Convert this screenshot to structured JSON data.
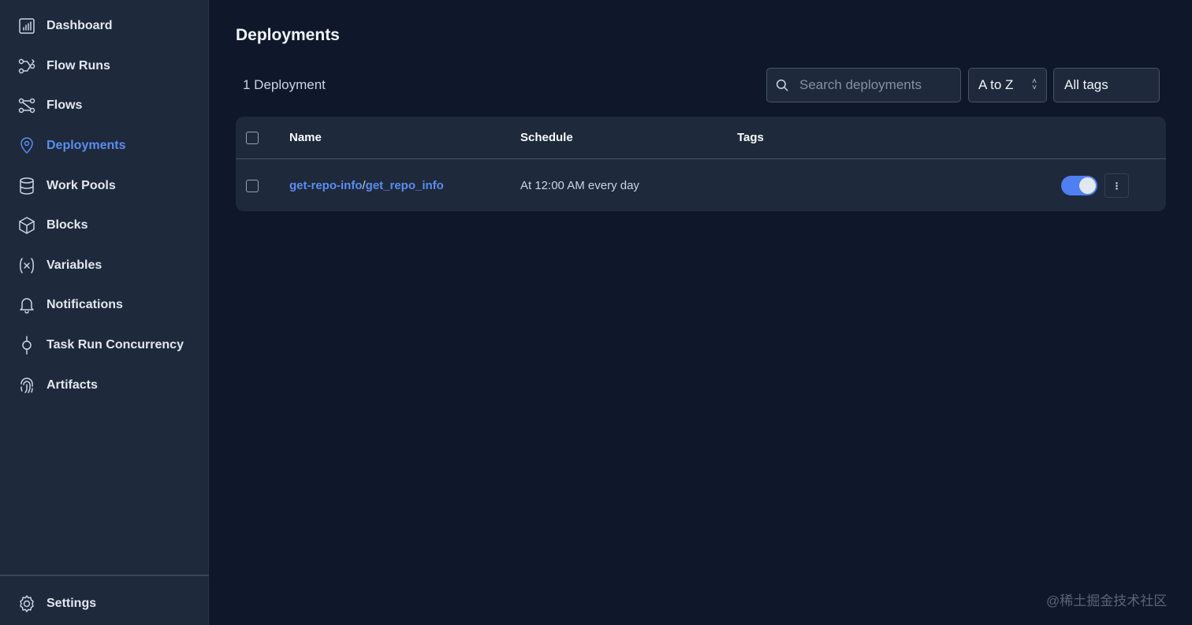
{
  "sidebar": {
    "items": [
      {
        "label": "Dashboard",
        "icon": "dashboard-icon"
      },
      {
        "label": "Flow Runs",
        "icon": "flow-runs-icon"
      },
      {
        "label": "Flows",
        "icon": "flows-icon"
      },
      {
        "label": "Deployments",
        "icon": "map-pin-icon",
        "active": true
      },
      {
        "label": "Work Pools",
        "icon": "database-icon"
      },
      {
        "label": "Blocks",
        "icon": "cube-icon"
      },
      {
        "label": "Variables",
        "icon": "variable-icon"
      },
      {
        "label": "Notifications",
        "icon": "bell-icon"
      },
      {
        "label": "Task Run Concurrency",
        "icon": "concurrency-icon"
      },
      {
        "label": "Artifacts",
        "icon": "fingerprint-icon"
      }
    ],
    "settings_label": "Settings"
  },
  "main": {
    "title": "Deployments",
    "count_label": "1 Deployment",
    "search_placeholder": "Search deployments",
    "sort_label": "A to Z",
    "tags_label": "All tags",
    "table": {
      "headers": {
        "name": "Name",
        "schedule": "Schedule",
        "tags": "Tags"
      },
      "rows": [
        {
          "flow_name": "get-repo-info",
          "separator": "/",
          "deployment_name": "get_repo_info",
          "schedule": "At 12:00 AM every day",
          "active": true
        }
      ]
    }
  },
  "watermark": "@稀土掘金技术社区",
  "colors": {
    "accent": "#5b8def",
    "sidebar_bg": "#1e293b",
    "page_bg": "#0f172a"
  }
}
